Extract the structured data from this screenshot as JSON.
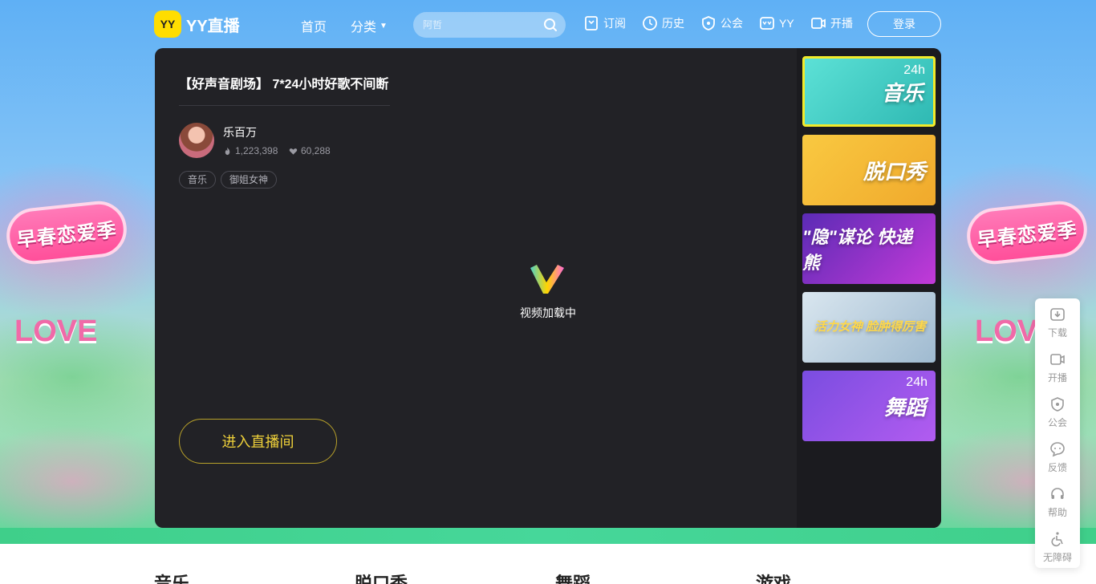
{
  "header": {
    "logo_badge": "YY",
    "logo_text": "YY直播",
    "nav_home": "首页",
    "nav_category": "分类",
    "search_placeholder": "阿哲",
    "subscribe": "订阅",
    "history": "历史",
    "guild": "公会",
    "yy": "YY",
    "live": "开播",
    "login": "登录"
  },
  "background": {
    "badge_text": "早春恋爱季",
    "love_text": "LOVE"
  },
  "room": {
    "title": "【好声音剧场】 7*24小时好歌不间断",
    "streamer": "乐百万",
    "views": "1,223,398",
    "likes": "60,288",
    "tags": [
      "音乐",
      "御姐女神"
    ],
    "loading_text": "视频加载中",
    "enter_button": "进入直播间"
  },
  "thumbnails": [
    {
      "label": "音乐",
      "badge": "24h"
    },
    {
      "label": "脱口秀",
      "badge": ""
    },
    {
      "label": "\"隐\"谋论 快递熊",
      "badge": ""
    },
    {
      "label": "活力女神 脸肿得厉害",
      "badge": ""
    },
    {
      "label": "舞蹈",
      "badge": "24h"
    }
  ],
  "sidebar": {
    "items": [
      "下载",
      "开播",
      "公会",
      "反馈",
      "帮助",
      "无障碍"
    ]
  },
  "categories": [
    "音乐",
    "脱口秀",
    "舞蹈",
    "游戏"
  ],
  "colors": {
    "panel": "#222226",
    "accent_yellow": "#f0d23a",
    "brand_yellow": "#ffdd00"
  }
}
